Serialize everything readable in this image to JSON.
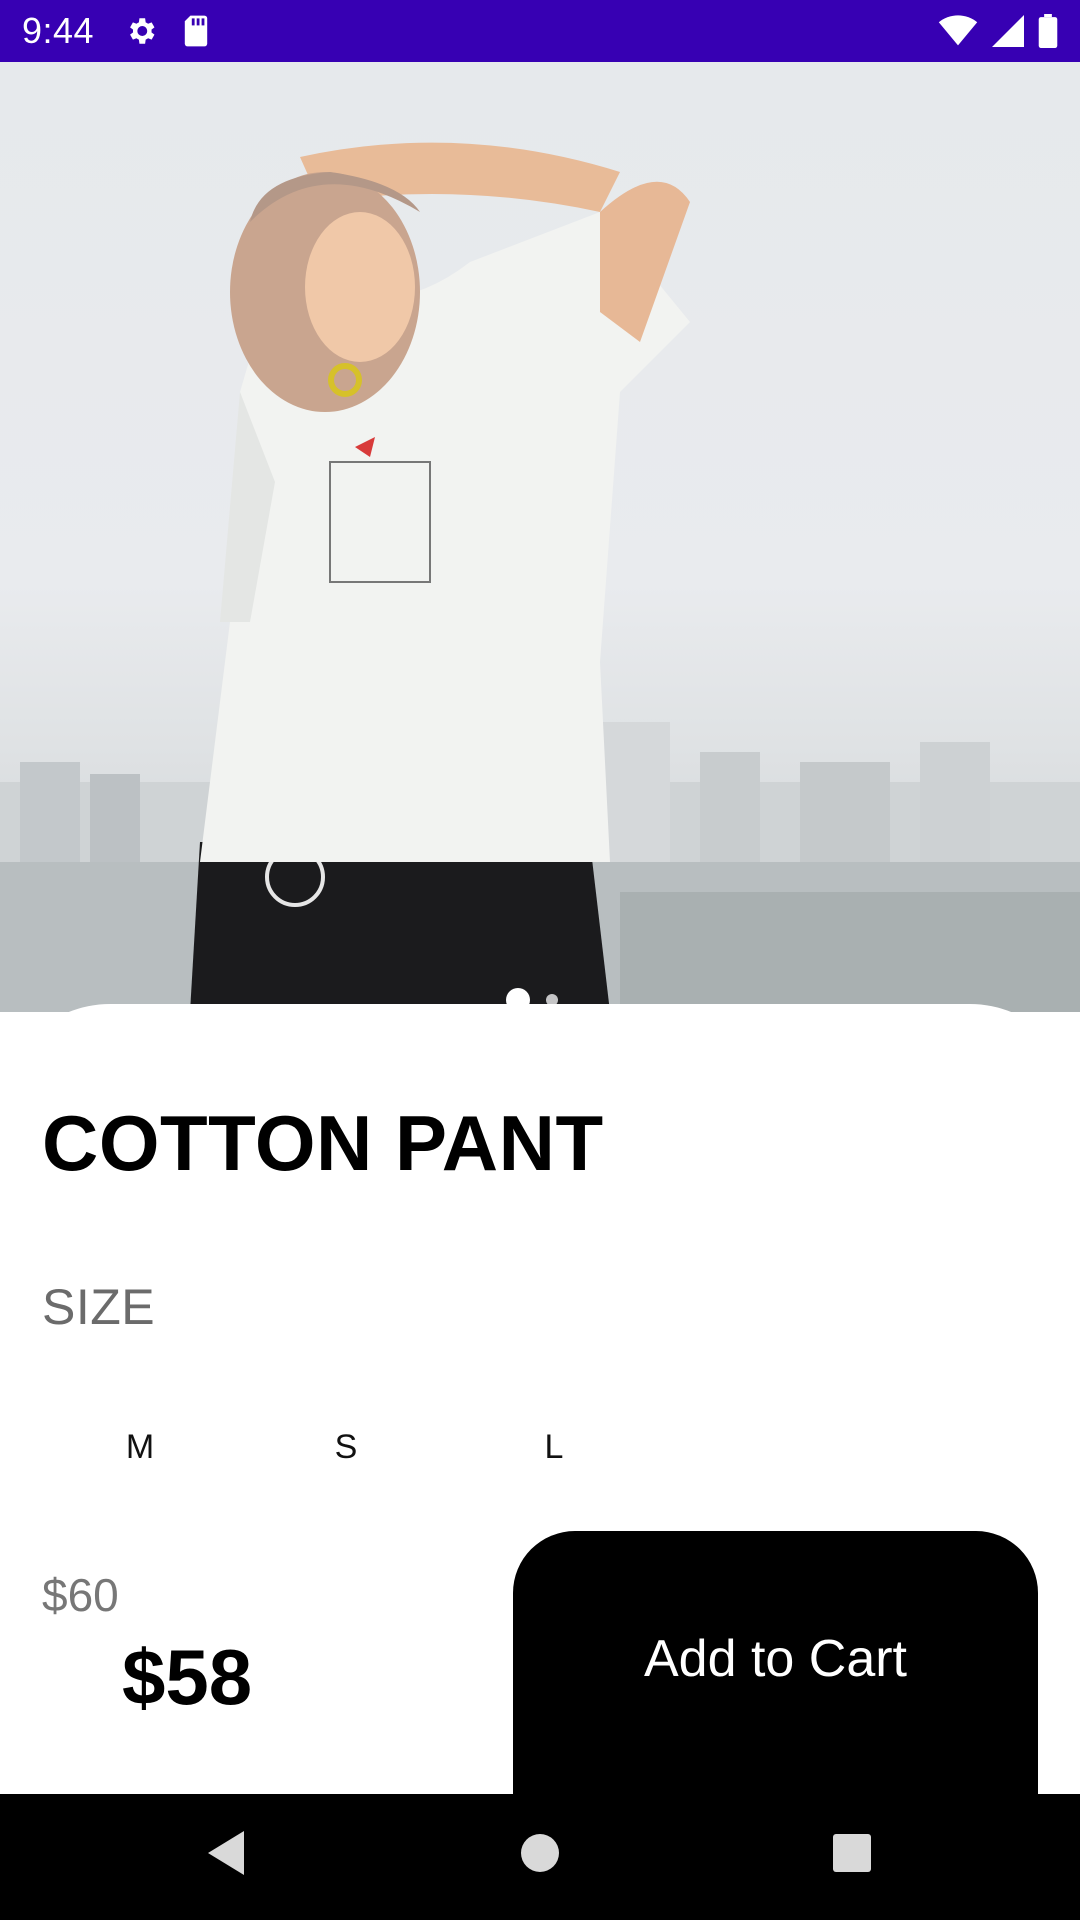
{
  "status_bar": {
    "time": "9:44",
    "left_icons": [
      "settings-icon",
      "sd-card-icon"
    ],
    "right_icons": [
      "wifi-icon",
      "cell-signal-icon",
      "battery-icon"
    ],
    "background": "#3700b3"
  },
  "hero": {
    "carousel": {
      "total": 2,
      "active": 0
    }
  },
  "product": {
    "title": "COTTON PANT",
    "size_label": "SIZE",
    "sizes": [
      "M",
      "S",
      "L"
    ],
    "old_price": "$60",
    "price": "$58"
  },
  "cart": {
    "label": "Add to Cart",
    "background": "#000000"
  },
  "nav_bar": {
    "icons": [
      "back-icon",
      "home-icon",
      "recents-icon"
    ]
  }
}
